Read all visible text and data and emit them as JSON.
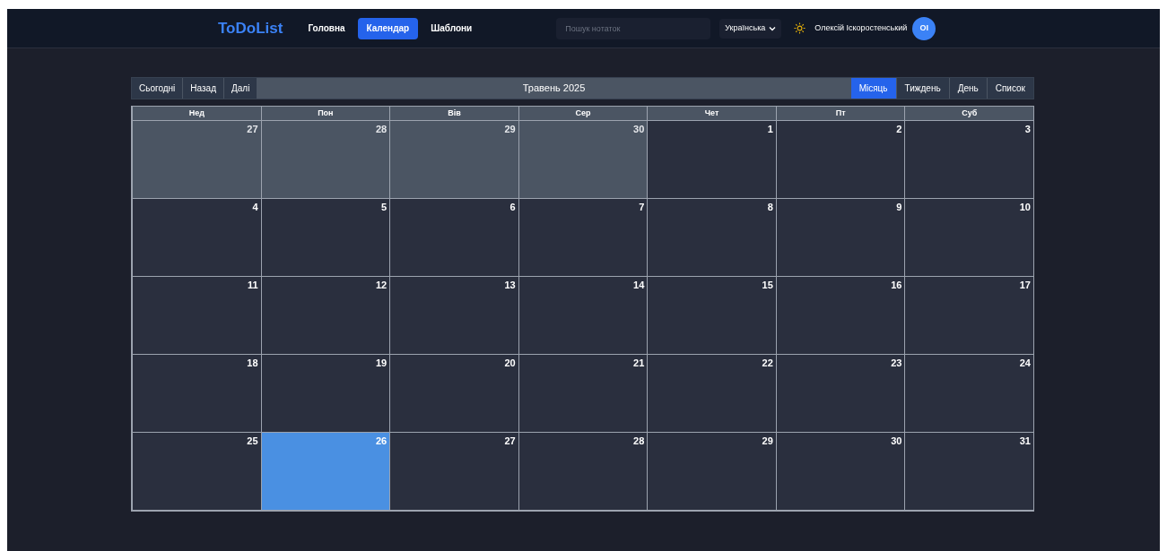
{
  "header": {
    "logo": "ToDoList",
    "nav": [
      {
        "label": "Головна",
        "selected": false
      },
      {
        "label": "Календар",
        "selected": true
      },
      {
        "label": "Шаблони",
        "selected": false
      }
    ],
    "search": {
      "placeholder": "Пошук нотаток"
    },
    "language": "Українська",
    "user": {
      "name": "Олексій Іскоростенський",
      "initials": "ОІ"
    }
  },
  "toolbar": {
    "nav_buttons": [
      "Сьогодні",
      "Назад",
      "Далі"
    ],
    "title": "Травень 2025",
    "views": [
      {
        "label": "Місяць",
        "selected": true
      },
      {
        "label": "Тиждень",
        "selected": false
      },
      {
        "label": "День",
        "selected": false
      },
      {
        "label": "Список",
        "selected": false
      }
    ]
  },
  "weekdays": [
    "Нед",
    "Пон",
    "Вів",
    "Сер",
    "Чет",
    "Пт",
    "Суб"
  ],
  "days": [
    {
      "day": "27",
      "other_month": true,
      "today": false
    },
    {
      "day": "28",
      "other_month": true,
      "today": false
    },
    {
      "day": "29",
      "other_month": true,
      "today": false
    },
    {
      "day": "30",
      "other_month": true,
      "today": false
    },
    {
      "day": "1",
      "other_month": false,
      "today": false
    },
    {
      "day": "2",
      "other_month": false,
      "today": false
    },
    {
      "day": "3",
      "other_month": false,
      "today": false
    },
    {
      "day": "4",
      "other_month": false,
      "today": false
    },
    {
      "day": "5",
      "other_month": false,
      "today": false
    },
    {
      "day": "6",
      "other_month": false,
      "today": false
    },
    {
      "day": "7",
      "other_month": false,
      "today": false
    },
    {
      "day": "8",
      "other_month": false,
      "today": false
    },
    {
      "day": "9",
      "other_month": false,
      "today": false
    },
    {
      "day": "10",
      "other_month": false,
      "today": false
    },
    {
      "day": "11",
      "other_month": false,
      "today": false
    },
    {
      "day": "12",
      "other_month": false,
      "today": false
    },
    {
      "day": "13",
      "other_month": false,
      "today": false
    },
    {
      "day": "14",
      "other_month": false,
      "today": false
    },
    {
      "day": "15",
      "other_month": false,
      "today": false
    },
    {
      "day": "16",
      "other_month": false,
      "today": false
    },
    {
      "day": "17",
      "other_month": false,
      "today": false
    },
    {
      "day": "18",
      "other_month": false,
      "today": false
    },
    {
      "day": "19",
      "other_month": false,
      "today": false
    },
    {
      "day": "20",
      "other_month": false,
      "today": false
    },
    {
      "day": "21",
      "other_month": false,
      "today": false
    },
    {
      "day": "22",
      "other_month": false,
      "today": false
    },
    {
      "day": "23",
      "other_month": false,
      "today": false
    },
    {
      "day": "24",
      "other_month": false,
      "today": false
    },
    {
      "day": "25",
      "other_month": false,
      "today": false
    },
    {
      "day": "26",
      "other_month": false,
      "today": true
    },
    {
      "day": "27",
      "other_month": false,
      "today": false
    },
    {
      "day": "28",
      "other_month": false,
      "today": false
    },
    {
      "day": "29",
      "other_month": false,
      "today": false
    },
    {
      "day": "30",
      "other_month": false,
      "today": false
    },
    {
      "day": "31",
      "other_month": false,
      "today": false
    }
  ]
}
